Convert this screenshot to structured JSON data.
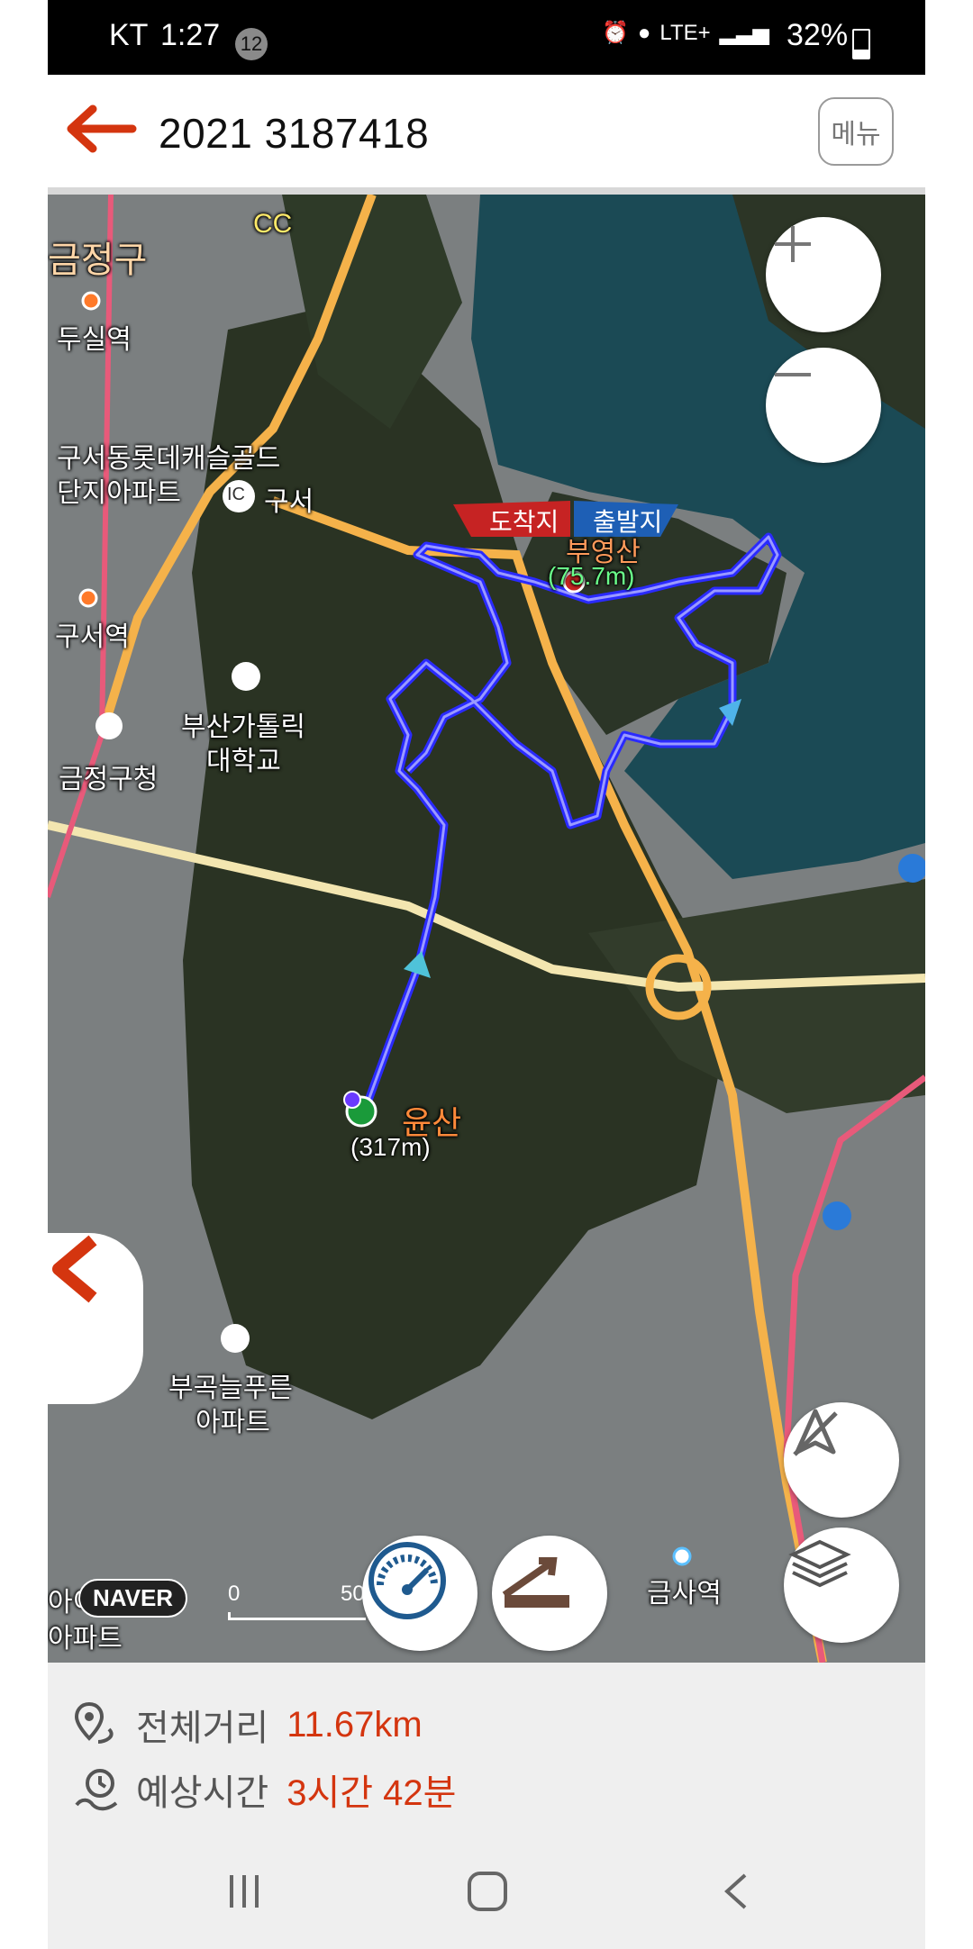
{
  "status_bar": {
    "carrier": "KT",
    "time": "1:27",
    "notification_count": "12",
    "network": "LTE+",
    "battery": "32%"
  },
  "header": {
    "title": "2021 3187418",
    "menu_label": "메뉴"
  },
  "map": {
    "labels": {
      "cc": "CC",
      "district_geumjeong": "금정구",
      "station_dusil": "두실역",
      "apt_guseo_1": "구서동롯데캐슬골드",
      "apt_guseo_2": "단지아파트",
      "ic_badge": "IC",
      "ic_guseo": "구서",
      "station_guseo": "구서역",
      "univ_1": "부산가톨릭",
      "univ_2": "대학교",
      "office_geumjeong": "금정구청",
      "peak_yunsan": "윤산",
      "peak_yunsan_height": "(317m)",
      "flag_arrival": "도착지",
      "flag_departure": "출발지",
      "peak_buyeong": "부영산",
      "peak_buyeong_height": "(75.7m)",
      "apt_bugok_1": "부곡늘푸른",
      "apt_bugok_2": "아파트",
      "station_geumsa": "금사역",
      "naver": "NAVER",
      "scale_zero": "0",
      "scale_value": "50",
      "apt_left_bottom_1": "아이",
      "apt_left_bottom_2": "아파트"
    },
    "colors": {
      "route": "#4b4bff",
      "road_major": "#f5b24a",
      "road_rail": "#e85a7a",
      "water": "#1b4a55",
      "forest": "#2a3323",
      "urban": "#7b7f80",
      "accent": "#d4350f"
    }
  },
  "info": {
    "distance_label": "전체거리",
    "distance_value": "11.67km",
    "time_label": "예상시간",
    "time_value": "3시간 42분"
  }
}
